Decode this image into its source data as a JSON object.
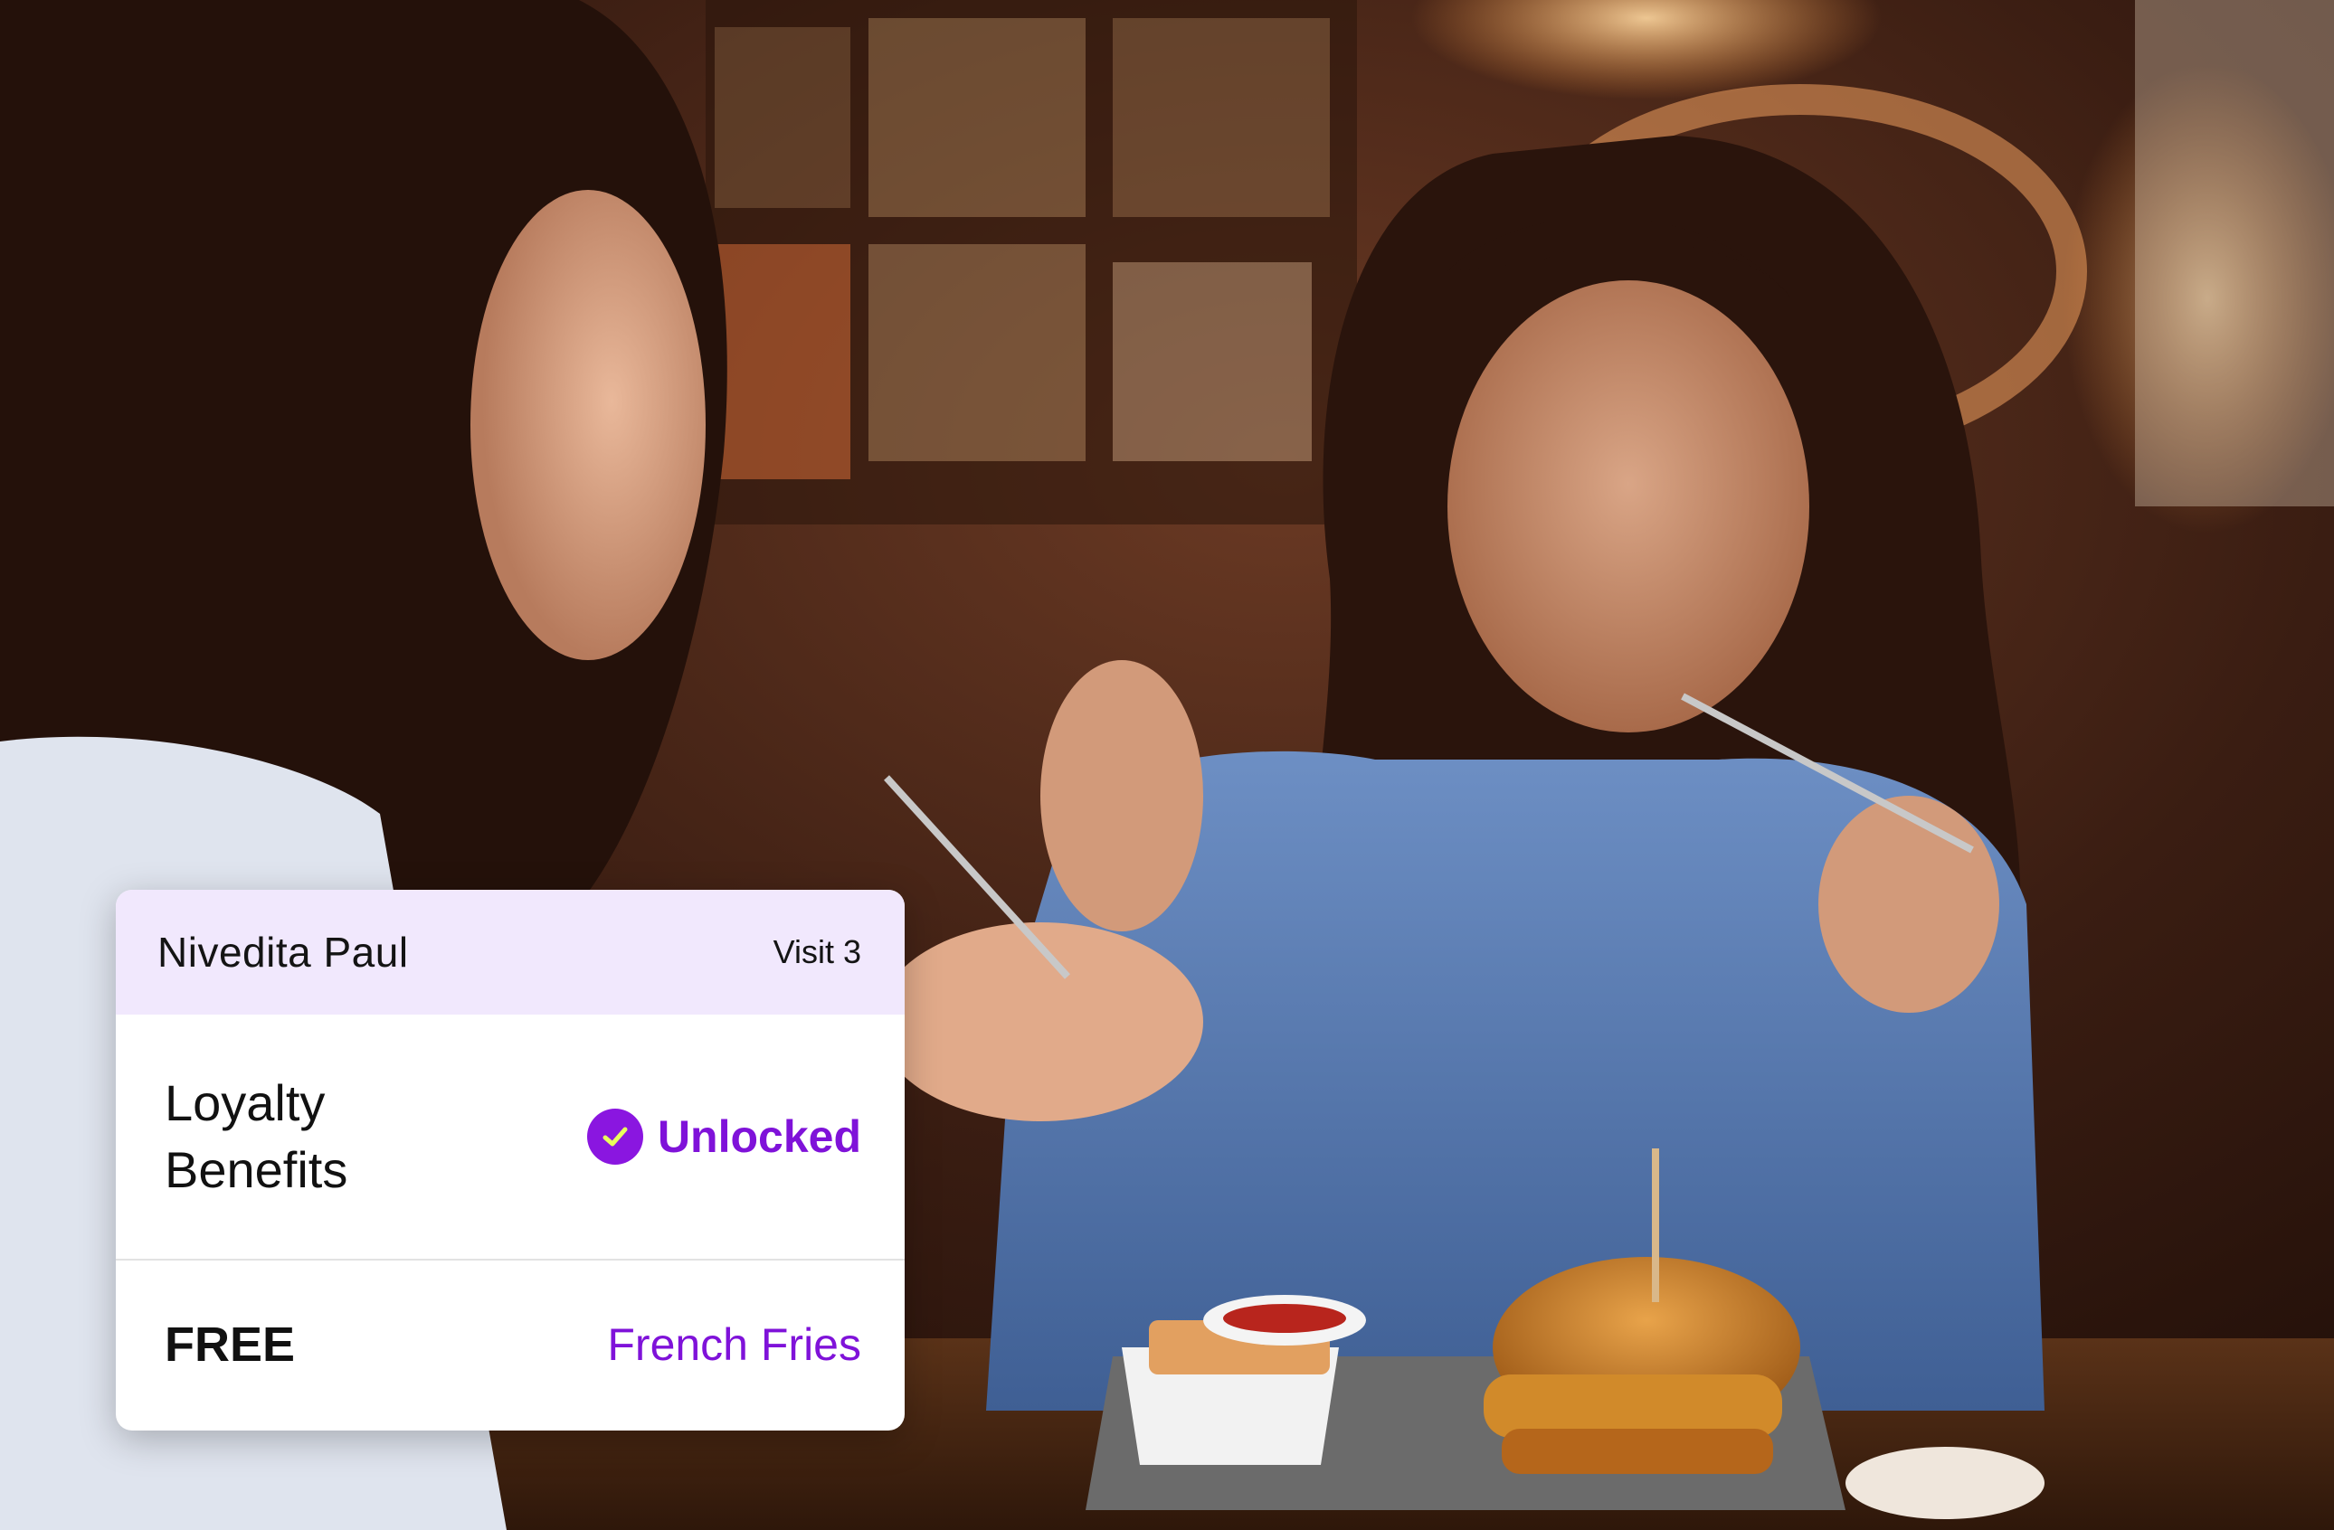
{
  "photo": {
    "subject": "restaurant-diners-photo"
  },
  "loyalty_card": {
    "customer_name": "Nivedita Paul",
    "visit_label": "Visit 3",
    "benefits_title": "Loyalty\nBenefits",
    "status_icon": "check-circle-icon",
    "status_text": "Unlocked",
    "reward_tag": "FREE",
    "reward_item": "French Fries",
    "accent_color": "#7f12d9",
    "header_color": "#f1e8fd"
  }
}
